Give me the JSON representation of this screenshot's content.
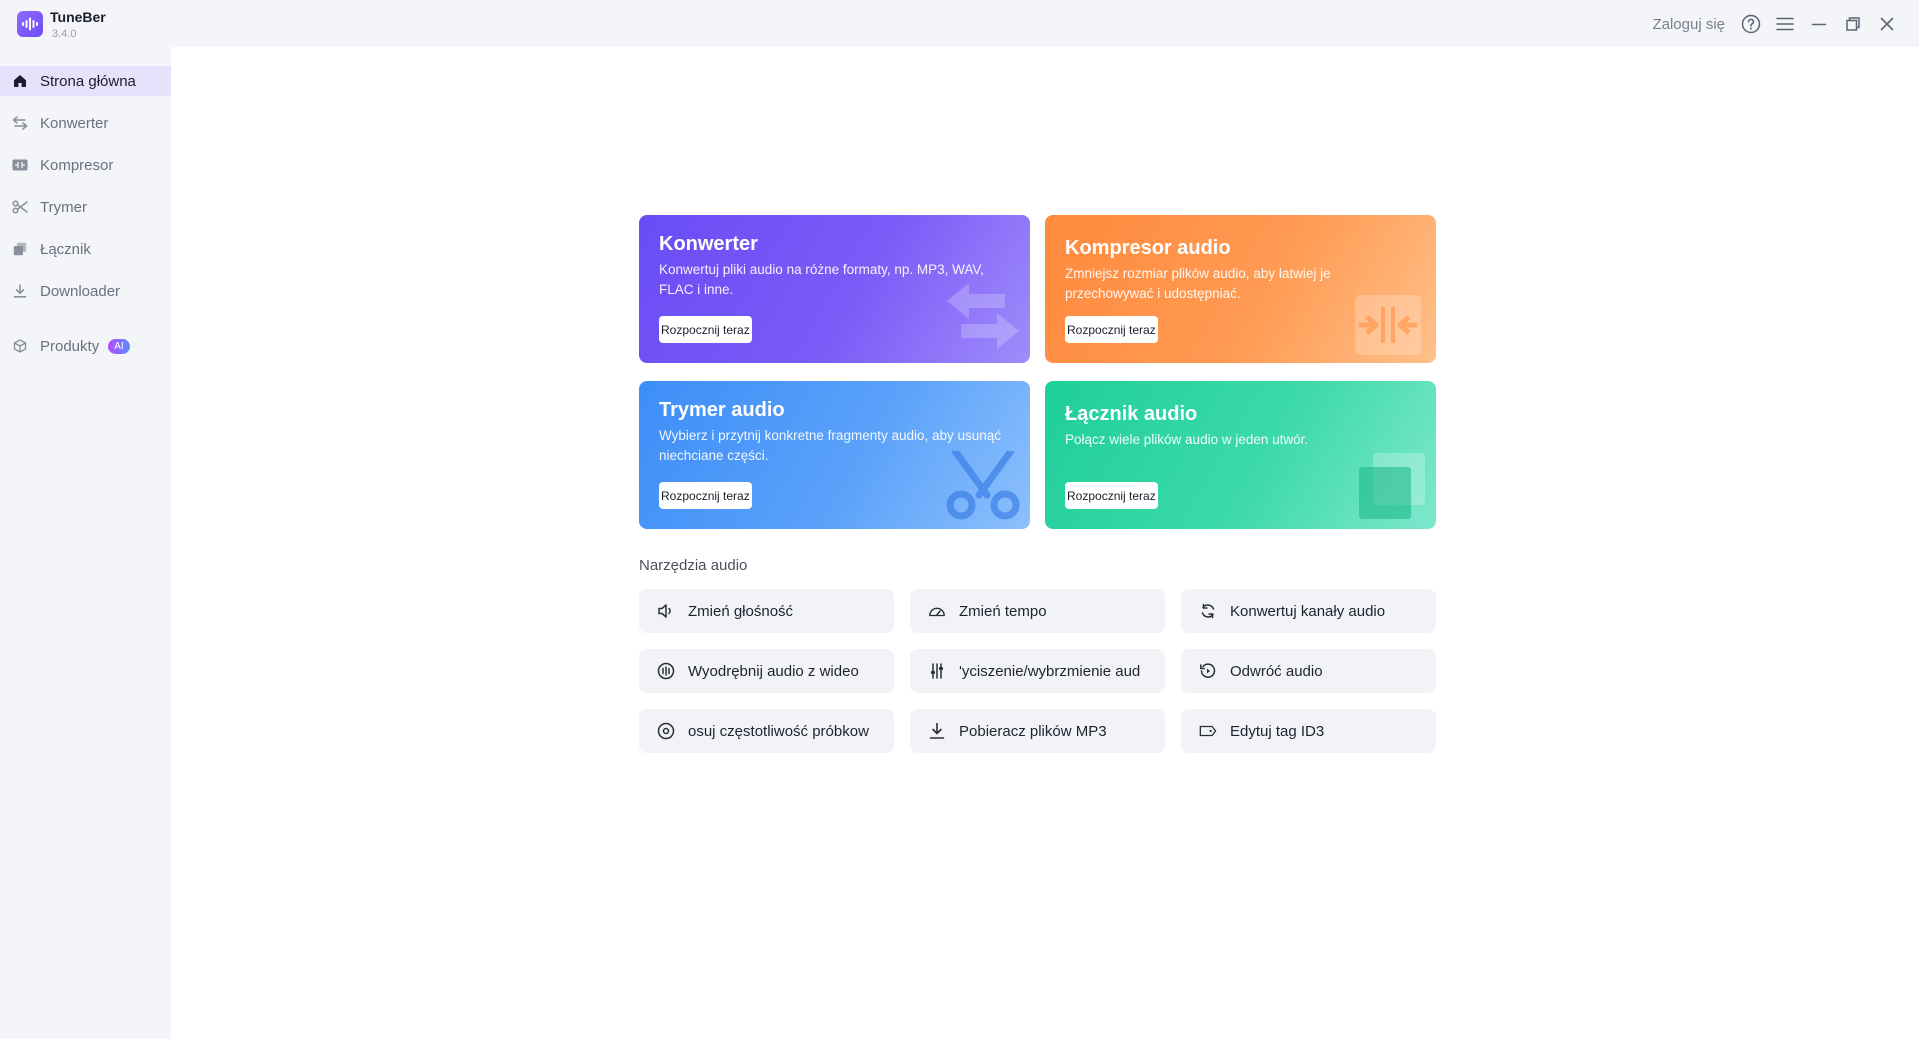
{
  "app": {
    "name": "TuneBer",
    "version": "3.4.0"
  },
  "titlebar": {
    "login": "Zaloguj się",
    "icons": [
      "help-icon",
      "menu-icon",
      "minimize-icon",
      "restore-icon",
      "close-icon"
    ]
  },
  "sidebar": {
    "items": [
      {
        "label": "Strona główna",
        "icon": "home-icon",
        "active": true
      },
      {
        "label": "Konwerter",
        "icon": "convert-arrows-icon"
      },
      {
        "label": "Kompresor",
        "icon": "compress-icon"
      },
      {
        "label": "Trymer",
        "icon": "scissors-icon"
      },
      {
        "label": "Łącznik",
        "icon": "merge-icon"
      },
      {
        "label": "Downloader",
        "icon": "download-icon"
      },
      {
        "label": "Produkty",
        "icon": "cube-icon",
        "badge": "AI"
      }
    ]
  },
  "cards": [
    {
      "title": "Konwerter",
      "desc": "Konwertuj pliki audio na różne formaty, np. MP3, WAV, FLAC i inne.",
      "button": "Rozpocznij teraz",
      "icon": "convert-arrows-icon"
    },
    {
      "title": "Kompresor audio",
      "desc": "Zmniejsz rozmiar plików audio, aby łatwiej je przechowywać i udostępniać.",
      "button": "Rozpocznij teraz",
      "icon": "compress-icon"
    },
    {
      "title": "Trymer audio",
      "desc": "Wybierz i przytnij konkretne fragmenty audio, aby usunąć niechciane części.",
      "button": "Rozpocznij teraz",
      "icon": "scissors-icon"
    },
    {
      "title": "Łącznik audio",
      "desc": "Połącz wiele plików audio w jeden utwór.",
      "button": "Rozpocznij teraz",
      "icon": "merge-icon"
    }
  ],
  "tools": {
    "heading": "Narzędzia audio",
    "items": [
      {
        "label": "Zmień głośność",
        "icon": "volume-icon"
      },
      {
        "label": "Zmień tempo",
        "icon": "speedometer-icon"
      },
      {
        "label": "Konwertuj kanały audio",
        "icon": "refresh-icon"
      },
      {
        "label": "Wyodrębnij audio z wideo",
        "icon": "audio-wave-icon"
      },
      {
        "label": "'yciszenie/wybrzmienie aud",
        "icon": "sliders-icon"
      },
      {
        "label": "Odwróć audio",
        "icon": "reverse-icon"
      },
      {
        "label": "osuj częstotliwość próbkow",
        "icon": "sample-rate-icon"
      },
      {
        "label": "Pobieracz plików MP3",
        "icon": "download-icon"
      },
      {
        "label": "Edytuj tag ID3",
        "icon": "tag-icon"
      }
    ]
  }
}
